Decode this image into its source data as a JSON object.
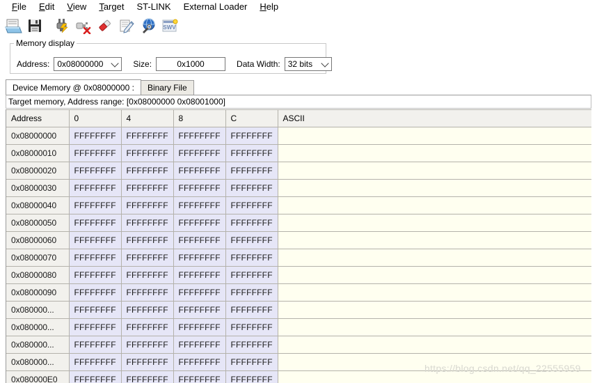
{
  "menu": {
    "items": [
      {
        "label": "File",
        "mnemonic": "F"
      },
      {
        "label": "Edit",
        "mnemonic": "E"
      },
      {
        "label": "View",
        "mnemonic": "V"
      },
      {
        "label": "Target",
        "mnemonic": "T"
      },
      {
        "label": "ST-LINK",
        "mnemonic": ""
      },
      {
        "label": "External Loader",
        "mnemonic": ""
      },
      {
        "label": "Help",
        "mnemonic": "H"
      }
    ]
  },
  "toolbar": {
    "buttons": [
      {
        "name": "open-file-icon",
        "title": "Open file"
      },
      {
        "name": "save-file-icon",
        "title": "Save file"
      },
      {
        "name": "connect-plug-icon",
        "title": "Connect to the target"
      },
      {
        "name": "disconnect-plug-icon",
        "title": "Disconnect from the target"
      },
      {
        "name": "erase-chip-icon",
        "title": "Erase chip"
      },
      {
        "name": "program-verify-icon",
        "title": "Program verify"
      },
      {
        "name": "settings-globe-icon",
        "title": "MCU core settings"
      },
      {
        "name": "swv-icon",
        "title": "Serial Wire Viewer",
        "label": "SWV",
        "disabled": true
      }
    ]
  },
  "memory_display": {
    "group_title": "Memory display",
    "address_label": "Address:",
    "address_value": "0x08000000",
    "size_label": "Size:",
    "size_value": "0x1000",
    "data_width_label": "Data Width:",
    "data_width_value": "32 bits"
  },
  "tabs": [
    {
      "label": "Device Memory @ 0x08000000 :",
      "active": true
    },
    {
      "label": "Binary File",
      "active": false
    }
  ],
  "status": {
    "text": "Target memory, Address range: [0x08000000 0x08001000]"
  },
  "table": {
    "headers": [
      "Address",
      "0",
      "4",
      "8",
      "C",
      "ASCII"
    ],
    "rows": [
      {
        "address": "0x08000000",
        "words": [
          "FFFFFFFF",
          "FFFFFFFF",
          "FFFFFFFF",
          "FFFFFFFF"
        ],
        "ascii": ""
      },
      {
        "address": "0x08000010",
        "words": [
          "FFFFFFFF",
          "FFFFFFFF",
          "FFFFFFFF",
          "FFFFFFFF"
        ],
        "ascii": ""
      },
      {
        "address": "0x08000020",
        "words": [
          "FFFFFFFF",
          "FFFFFFFF",
          "FFFFFFFF",
          "FFFFFFFF"
        ],
        "ascii": ""
      },
      {
        "address": "0x08000030",
        "words": [
          "FFFFFFFF",
          "FFFFFFFF",
          "FFFFFFFF",
          "FFFFFFFF"
        ],
        "ascii": ""
      },
      {
        "address": "0x08000040",
        "words": [
          "FFFFFFFF",
          "FFFFFFFF",
          "FFFFFFFF",
          "FFFFFFFF"
        ],
        "ascii": ""
      },
      {
        "address": "0x08000050",
        "words": [
          "FFFFFFFF",
          "FFFFFFFF",
          "FFFFFFFF",
          "FFFFFFFF"
        ],
        "ascii": ""
      },
      {
        "address": "0x08000060",
        "words": [
          "FFFFFFFF",
          "FFFFFFFF",
          "FFFFFFFF",
          "FFFFFFFF"
        ],
        "ascii": ""
      },
      {
        "address": "0x08000070",
        "words": [
          "FFFFFFFF",
          "FFFFFFFF",
          "FFFFFFFF",
          "FFFFFFFF"
        ],
        "ascii": ""
      },
      {
        "address": "0x08000080",
        "words": [
          "FFFFFFFF",
          "FFFFFFFF",
          "FFFFFFFF",
          "FFFFFFFF"
        ],
        "ascii": ""
      },
      {
        "address": "0x08000090",
        "words": [
          "FFFFFFFF",
          "FFFFFFFF",
          "FFFFFFFF",
          "FFFFFFFF"
        ],
        "ascii": ""
      },
      {
        "address": "0x080000...",
        "words": [
          "FFFFFFFF",
          "FFFFFFFF",
          "FFFFFFFF",
          "FFFFFFFF"
        ],
        "ascii": ""
      },
      {
        "address": "0x080000...",
        "words": [
          "FFFFFFFF",
          "FFFFFFFF",
          "FFFFFFFF",
          "FFFFFFFF"
        ],
        "ascii": ""
      },
      {
        "address": "0x080000...",
        "words": [
          "FFFFFFFF",
          "FFFFFFFF",
          "FFFFFFFF",
          "FFFFFFFF"
        ],
        "ascii": ""
      },
      {
        "address": "0x080000...",
        "words": [
          "FFFFFFFF",
          "FFFFFFFF",
          "FFFFFFFF",
          "FFFFFFFF"
        ],
        "ascii": ""
      },
      {
        "address": "0x080000E0",
        "words": [
          "FFFFFFFF",
          "FFFFFFFF",
          "FFFFFFFF",
          "FFFFFFFF"
        ],
        "ascii": ""
      }
    ]
  },
  "watermark": {
    "text": "https://blog.csdn.net/qq_22555959"
  }
}
